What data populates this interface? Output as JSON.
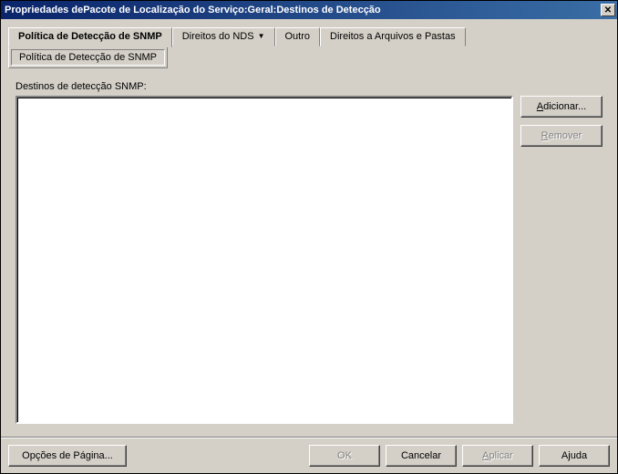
{
  "window": {
    "title": "Propriedades dePacote de Localização do Serviço:Geral:Destinos de Detecção"
  },
  "tabs": {
    "items": [
      {
        "label": "Política de Detecção de SNMP"
      },
      {
        "label": "Direitos do NDS"
      },
      {
        "label": "Outro"
      },
      {
        "label": "Direitos a Arquivos e Pastas"
      }
    ]
  },
  "subtabs": {
    "items": [
      {
        "label": "Política de Detecção de SNMP"
      }
    ]
  },
  "panel": {
    "list_label": "Destinos de detecção SNMP:"
  },
  "side": {
    "add_prefix": "A",
    "add_rest": "dicionar...",
    "remove_prefix": "R",
    "remove_rest": "emover"
  },
  "bottom": {
    "page_options": "Opções de Página...",
    "ok": "OK",
    "cancel": "Cancelar",
    "apply_prefix": "A",
    "apply_rest": "plicar",
    "help": "Ajuda"
  }
}
